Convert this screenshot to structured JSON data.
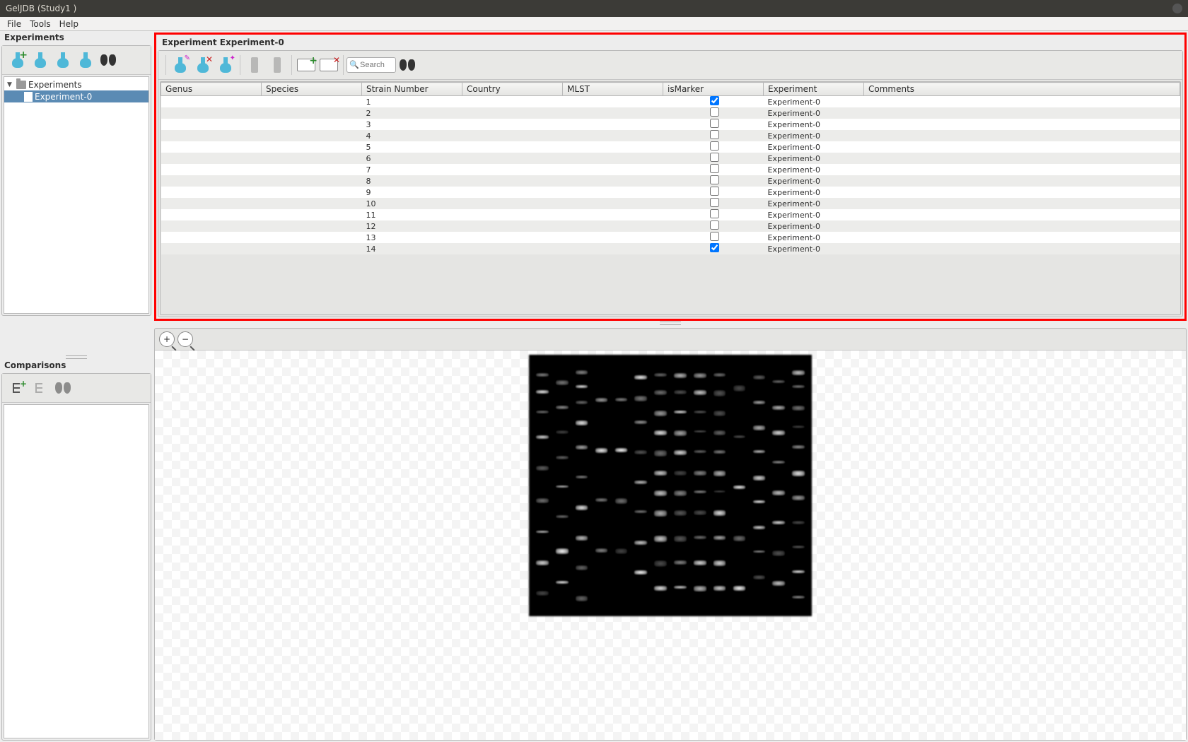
{
  "window": {
    "title": "GelJDB (Study1 )"
  },
  "menu": {
    "file": "File",
    "tools": "Tools",
    "help": "Help"
  },
  "panels": {
    "experiments_header": "Experiments",
    "comparisons_header": "Comparisons",
    "experiment_title": "Experiment Experiment-0"
  },
  "tree": {
    "root": "Experiments",
    "item0": "Experiment-0"
  },
  "search": {
    "placeholder": "Search"
  },
  "grid": {
    "headers": {
      "genus": "Genus",
      "species": "Species",
      "strain": "Strain Number",
      "country": "Country",
      "mlst": "MLST",
      "marker": "isMarker",
      "experiment": "Experiment",
      "comments": "Comments"
    },
    "rows": [
      {
        "strain": "1",
        "marker": true,
        "experiment": "Experiment-0"
      },
      {
        "strain": "2",
        "marker": false,
        "experiment": "Experiment-0"
      },
      {
        "strain": "3",
        "marker": false,
        "experiment": "Experiment-0"
      },
      {
        "strain": "4",
        "marker": false,
        "experiment": "Experiment-0"
      },
      {
        "strain": "5",
        "marker": false,
        "experiment": "Experiment-0"
      },
      {
        "strain": "6",
        "marker": false,
        "experiment": "Experiment-0"
      },
      {
        "strain": "7",
        "marker": false,
        "experiment": "Experiment-0"
      },
      {
        "strain": "8",
        "marker": false,
        "experiment": "Experiment-0"
      },
      {
        "strain": "9",
        "marker": false,
        "experiment": "Experiment-0"
      },
      {
        "strain": "10",
        "marker": false,
        "experiment": "Experiment-0"
      },
      {
        "strain": "11",
        "marker": false,
        "experiment": "Experiment-0"
      },
      {
        "strain": "12",
        "marker": false,
        "experiment": "Experiment-0"
      },
      {
        "strain": "13",
        "marker": false,
        "experiment": "Experiment-0"
      },
      {
        "strain": "14",
        "marker": true,
        "experiment": "Experiment-0"
      }
    ]
  }
}
